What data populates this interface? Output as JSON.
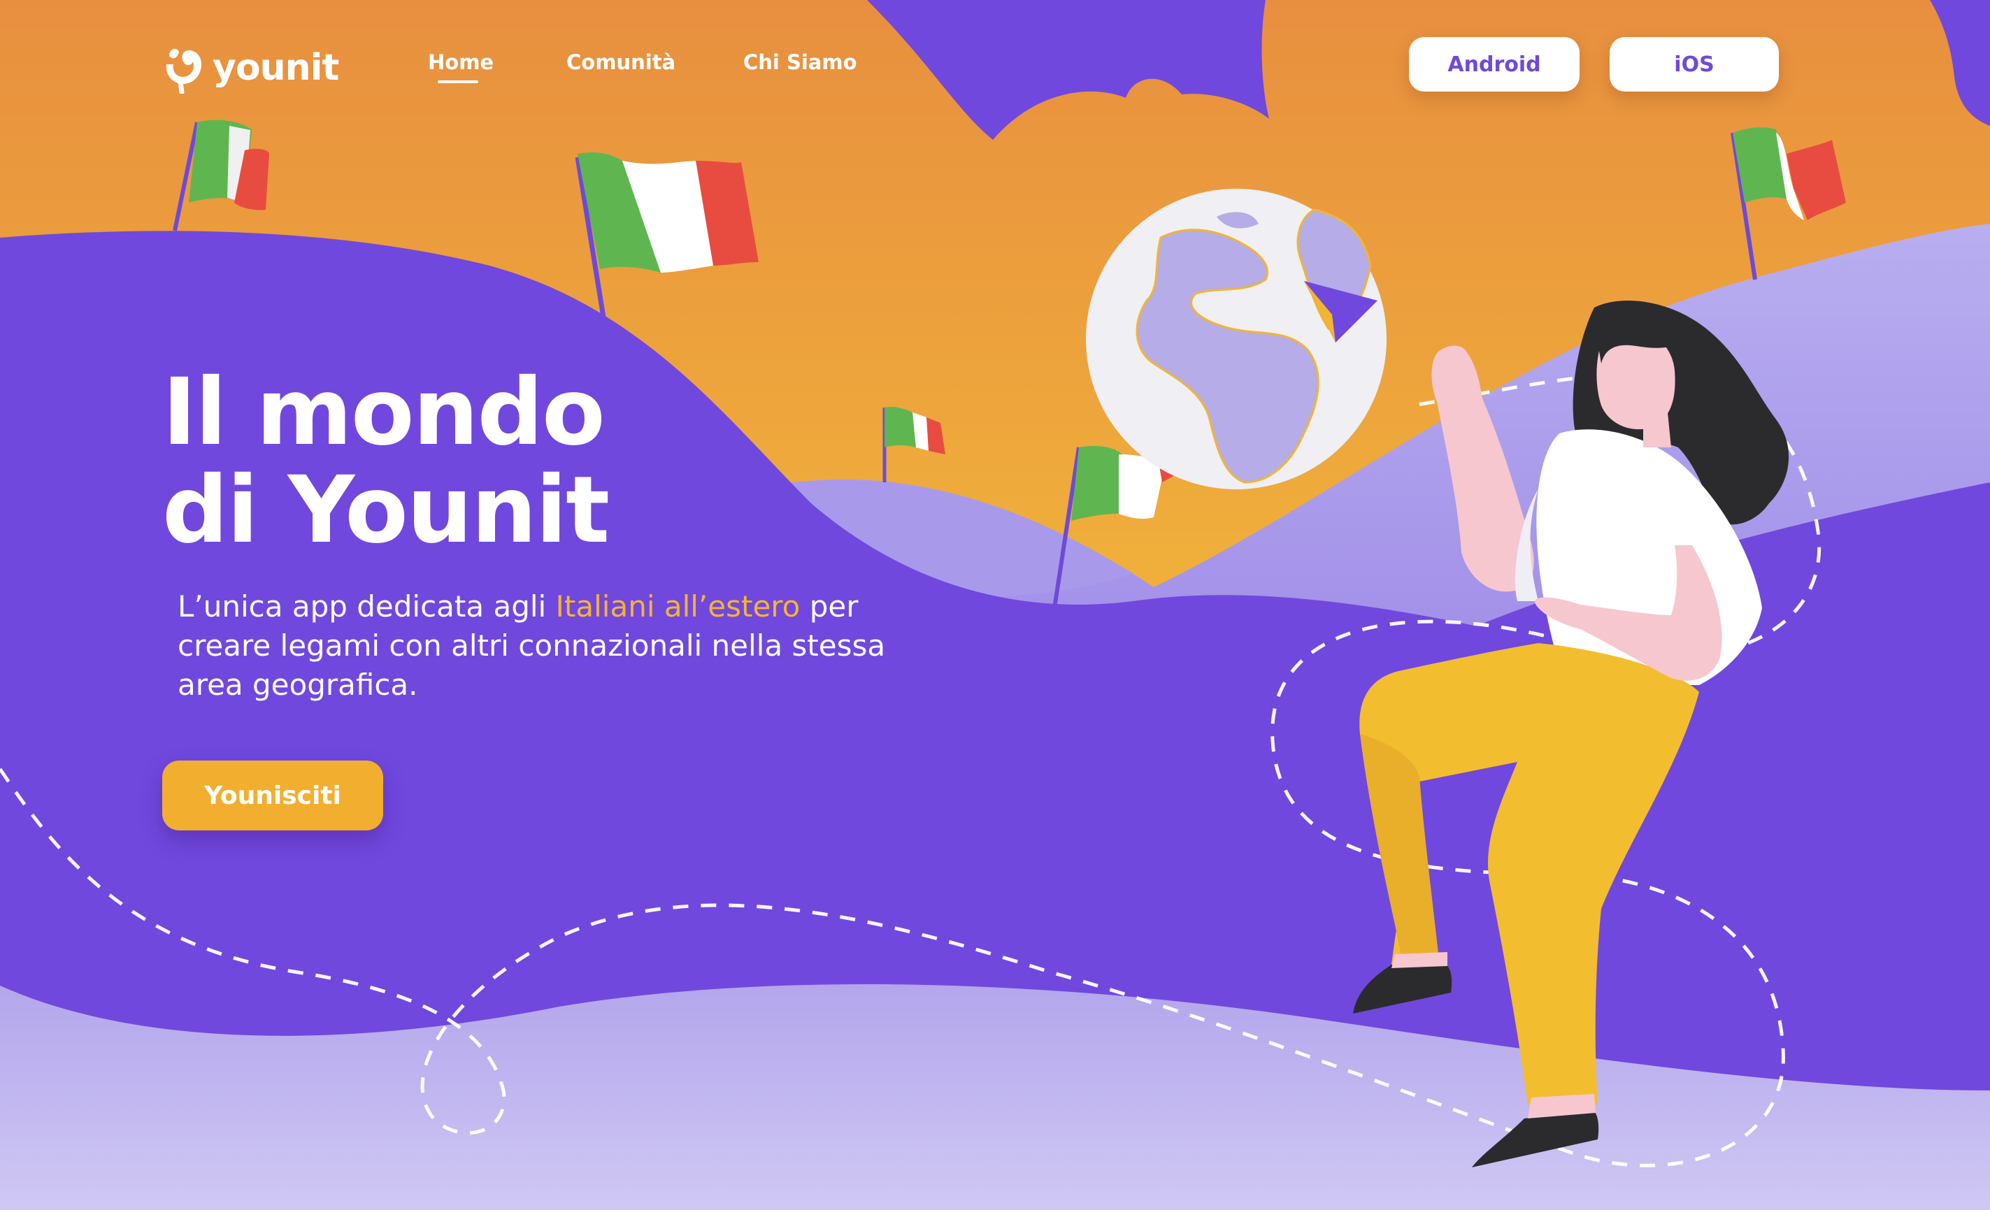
{
  "brand": {
    "logo_text": "younit"
  },
  "nav": {
    "items": [
      {
        "label": "Home",
        "active": true
      },
      {
        "label": "Comunità",
        "active": false
      },
      {
        "label": "Chi Siamo",
        "active": false
      }
    ]
  },
  "store_buttons": {
    "android": "Android",
    "ios": "iOS"
  },
  "hero": {
    "title_line1": "Il mondo",
    "title_line2": "di Younit",
    "subtitle_before": "L’unica app dedicata agli ",
    "subtitle_highlight": "Italiani all’estero",
    "subtitle_after": " per creare legami con altri connazionali nella stessa area geografica.",
    "cta": "Younisciti"
  },
  "colors": {
    "purple": "#7048de",
    "orange": "#e8913e",
    "yellow": "#f3c23a",
    "cta": "#f2af2f",
    "highlight": "#f5b335",
    "lavender": "#c9bff0"
  },
  "icons": [
    "younit-logo-icon",
    "globe-icon",
    "paper-plane-icon",
    "italian-flag-icon"
  ]
}
